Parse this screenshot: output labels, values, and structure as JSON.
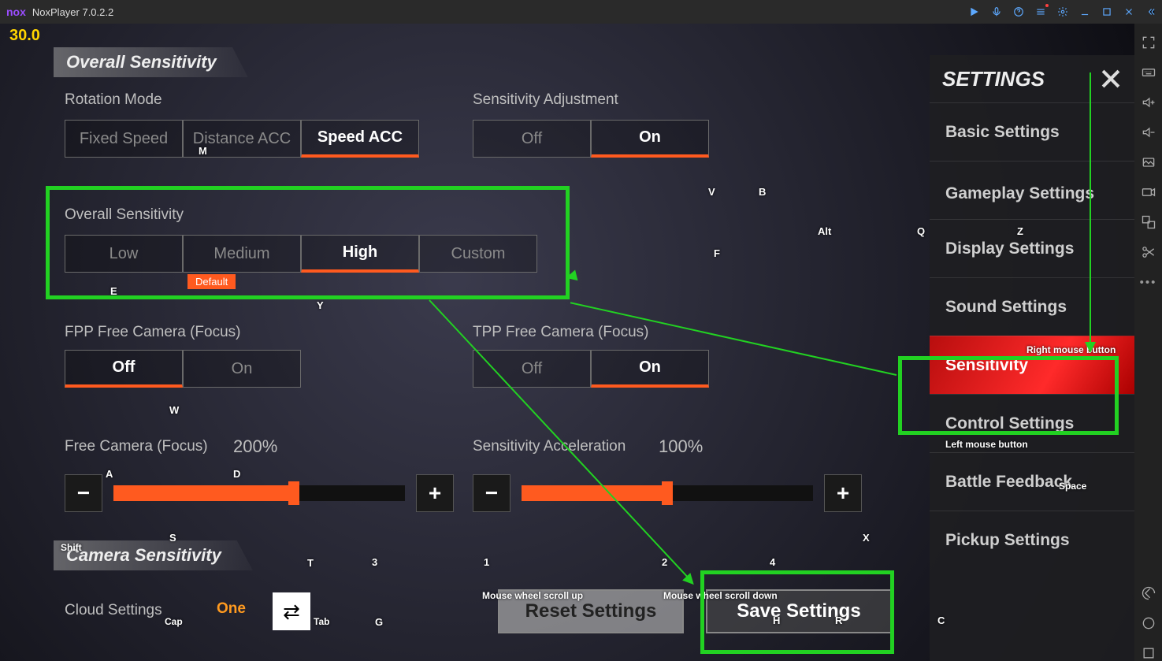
{
  "titlebar": {
    "logo": "nox",
    "app_title": "NoxPlayer 7.0.2.2"
  },
  "fps": "30.0",
  "section_overall": "Overall Sensitivity",
  "rotation": {
    "label": "Rotation Mode",
    "opts": [
      "Fixed Speed",
      "Distance ACC",
      "Speed ACC"
    ]
  },
  "sens_adj": {
    "label": "Sensitivity Adjustment",
    "opts": [
      "Off",
      "On"
    ]
  },
  "overall_sens": {
    "label": "Overall Sensitivity",
    "opts": [
      "Low",
      "Medium",
      "High",
      "Custom"
    ],
    "default_badge": "Default"
  },
  "fpp": {
    "label": "FPP Free Camera (Focus)",
    "opts": [
      "Off",
      "On"
    ]
  },
  "tpp": {
    "label": "TPP Free Camera (Focus)",
    "opts": [
      "Off",
      "On"
    ]
  },
  "freecam": {
    "label": "Free Camera (Focus)",
    "value": "200%"
  },
  "sensaccel": {
    "label": "Sensitivity Acceleration",
    "value": "100%"
  },
  "section_camera": "Camera Sensitivity",
  "cloud": {
    "label": "Cloud Settings",
    "value": "One"
  },
  "reset_btn": "Reset Settings",
  "save_btn": "Save Settings",
  "panel": {
    "header": "SETTINGS",
    "items": [
      "Basic Settings",
      "Gameplay Settings",
      "Display Settings",
      "Sound Settings",
      "Sensitivity",
      "Control Settings",
      "Battle Feedback",
      "Pickup Settings"
    ]
  },
  "keys": {
    "M": "M",
    "V": "V",
    "B": "B",
    "Alt": "Alt",
    "Q": "Q",
    "Z": "Z",
    "F": "F",
    "E": "E",
    "Y": "Y",
    "W": "W",
    "A": "A",
    "D": "D",
    "Shift": "Shift",
    "S": "S",
    "T": "T",
    "n3": "3",
    "n1": "1",
    "n2": "2",
    "n4": "4",
    "X": "X",
    "Cap": "Cap",
    "Tab": "Tab",
    "G": "G",
    "H": "H",
    "R": "R",
    "C": "C",
    "Space": "Space",
    "lmb": "Left mouse button",
    "rmb": "Right mouse button",
    "mwu": "Mouse wheel scroll up",
    "mwd": "Mouse wheel scroll down"
  }
}
